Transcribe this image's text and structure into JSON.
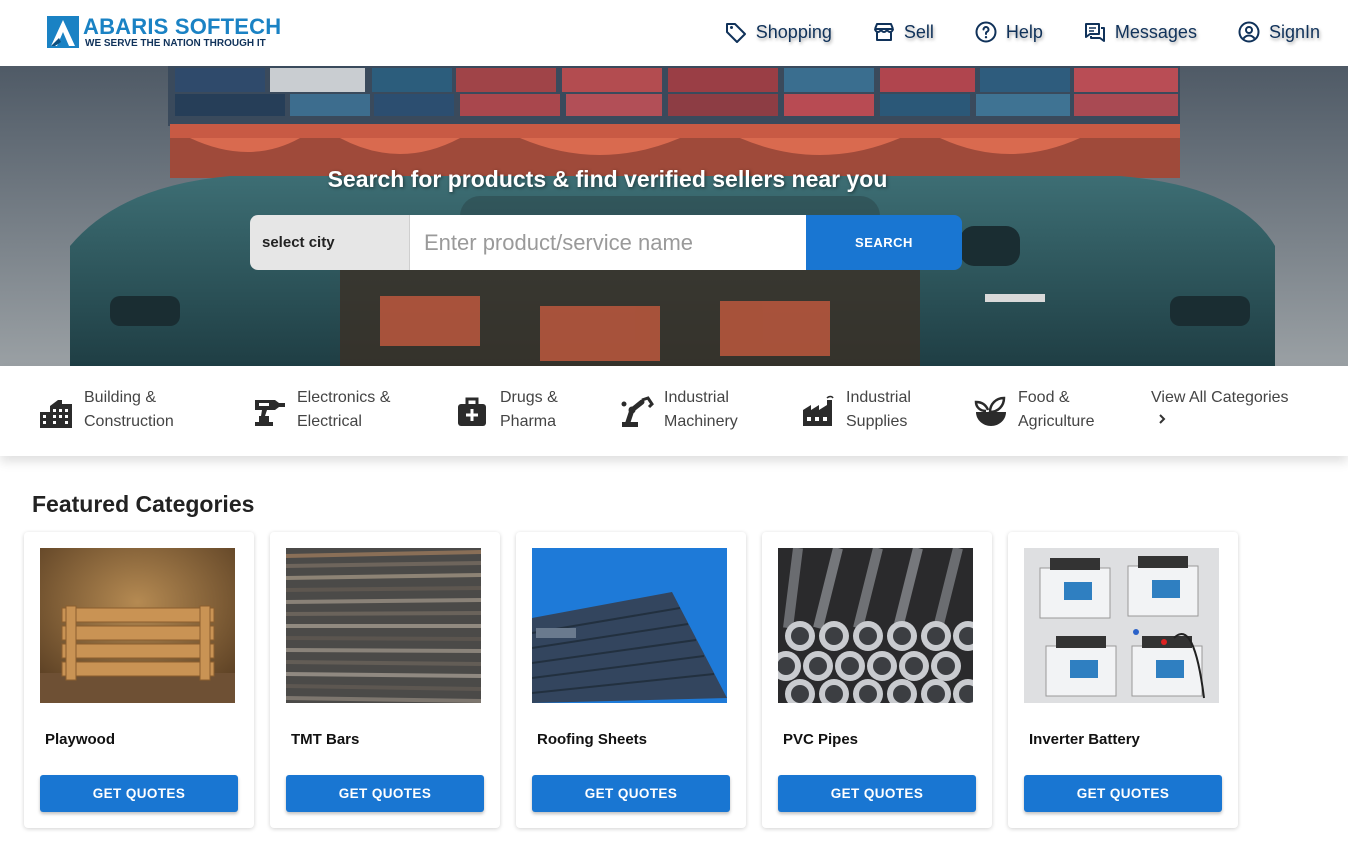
{
  "brand": {
    "name": "ABARIS SOFTECH",
    "tagline": "WE SERVE THE NATION THROUGH IT",
    "colors": {
      "primary": "#1a82c4",
      "navy": "#10325a",
      "button": "#1976d2"
    }
  },
  "nav": [
    {
      "label": "Shopping",
      "icon": "tag-icon"
    },
    {
      "label": "Sell",
      "icon": "store-icon"
    },
    {
      "label": "Help",
      "icon": "help-icon"
    },
    {
      "label": "Messages",
      "icon": "messages-icon"
    },
    {
      "label": "SignIn",
      "icon": "account-icon"
    }
  ],
  "hero": {
    "title": "Search for products & find verified sellers near you",
    "city_select": "select city",
    "search_placeholder": "Enter product/service name",
    "search_button": "SEARCH"
  },
  "categories": [
    {
      "label_line1": "Building &",
      "label_line2": "Construction",
      "icon": "building-icon"
    },
    {
      "label_line1": "Electronics &",
      "label_line2": "Electrical",
      "icon": "drill-icon"
    },
    {
      "label_line1": "Drugs &",
      "label_line2": "Pharma",
      "icon": "medical-kit-icon"
    },
    {
      "label_line1": "Industrial",
      "label_line2": "Machinery",
      "icon": "robot-arm-icon"
    },
    {
      "label_line1": "Industrial",
      "label_line2": "Supplies",
      "icon": "factory-icon"
    },
    {
      "label_line1": "Food &",
      "label_line2": "Agriculture",
      "icon": "plant-bowl-icon"
    }
  ],
  "view_all": "View All Categories",
  "featured": {
    "title": "Featured Categories",
    "items": [
      {
        "name": "Playwood",
        "button": "GET QUOTES"
      },
      {
        "name": "TMT Bars",
        "button": "GET QUOTES"
      },
      {
        "name": "Roofing Sheets",
        "button": "GET QUOTES"
      },
      {
        "name": "PVC Pipes",
        "button": "GET QUOTES"
      },
      {
        "name": "Inverter Battery",
        "button": "GET QUOTES"
      }
    ]
  }
}
